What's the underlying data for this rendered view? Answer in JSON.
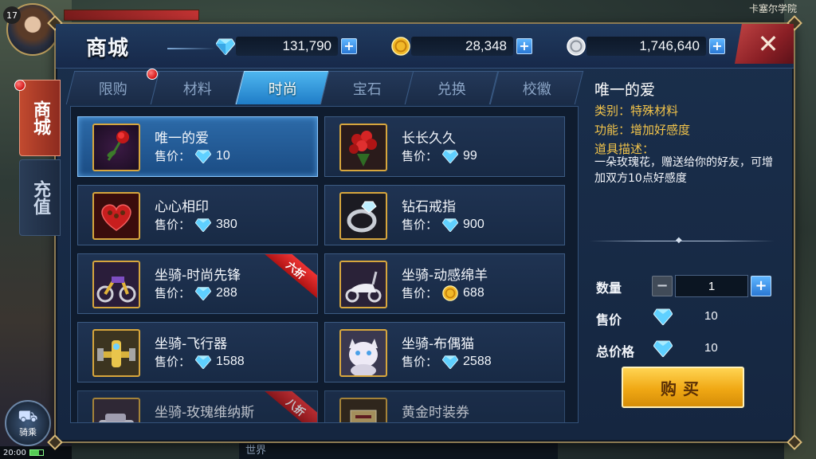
{
  "hud": {
    "level": "17",
    "location": "卡塞尔学院",
    "ride_label": "骑乘",
    "clock": "20:00",
    "world_chat": "世界"
  },
  "shop": {
    "title": "商城",
    "currencies": {
      "diamond": "131,790",
      "gold": "28,348",
      "silver": "1,746,640"
    },
    "side_tabs": [
      "商城",
      "充值"
    ],
    "category_tabs": [
      {
        "label": "限购",
        "active": false,
        "red_dot": true
      },
      {
        "label": "材料",
        "active": false
      },
      {
        "label": "时尚",
        "active": true
      },
      {
        "label": "宝石",
        "active": false
      },
      {
        "label": "兑换",
        "active": false
      },
      {
        "label": "校徽",
        "active": false
      }
    ],
    "price_label": "售价：",
    "items": [
      {
        "name": "唯一的爱",
        "price": "10",
        "currency": "diamond",
        "selected": true,
        "icon": "rose-icon"
      },
      {
        "name": "长长久久",
        "price": "99",
        "currency": "diamond",
        "icon": "bouquet-icon"
      },
      {
        "name": "心心相印",
        "price": "380",
        "currency": "diamond",
        "icon": "heart-box-icon"
      },
      {
        "name": "钻石戒指",
        "price": "900",
        "currency": "diamond",
        "icon": "ring-icon"
      },
      {
        "name": "坐骑-时尚先锋",
        "price": "288",
        "currency": "diamond",
        "discount": "六折",
        "icon": "motorcycle-icon"
      },
      {
        "name": "坐骑-动感绵羊",
        "price": "688",
        "currency": "gold",
        "icon": "scooter-icon"
      },
      {
        "name": "坐骑-飞行器",
        "price": "1588",
        "currency": "diamond",
        "icon": "aircraft-icon"
      },
      {
        "name": "坐骑-布偶猫",
        "price": "2588",
        "currency": "diamond",
        "icon": "cat-icon"
      },
      {
        "name": "坐骑-玫瑰维纳斯",
        "price": "",
        "currency": "diamond",
        "discount": "八折",
        "icon": "car-icon"
      },
      {
        "name": "黄金时装券",
        "price": "",
        "currency": "diamond",
        "icon": "voucher-icon"
      }
    ],
    "detail": {
      "name": "唯一的爱",
      "category": "类别：特殊材料",
      "function": "功能：增加好感度",
      "desc_title": "道具描述：",
      "desc": "一朵玫瑰花，赠送给你的好友，可增加双方10点好感度",
      "qty_label": "数量",
      "qty_value": "1",
      "price_label": "售价",
      "price_value": "10",
      "total_label": "总价格",
      "total_value": "10",
      "buy_label": "购买"
    }
  },
  "colors": {
    "panel_bg": "#17294a",
    "active_tab": "#2a8fd8",
    "side_tab_active": "#b53e29",
    "price_gold": "#f1c34a",
    "buy_button": "#f0a814",
    "close_red": "#a12a30"
  }
}
